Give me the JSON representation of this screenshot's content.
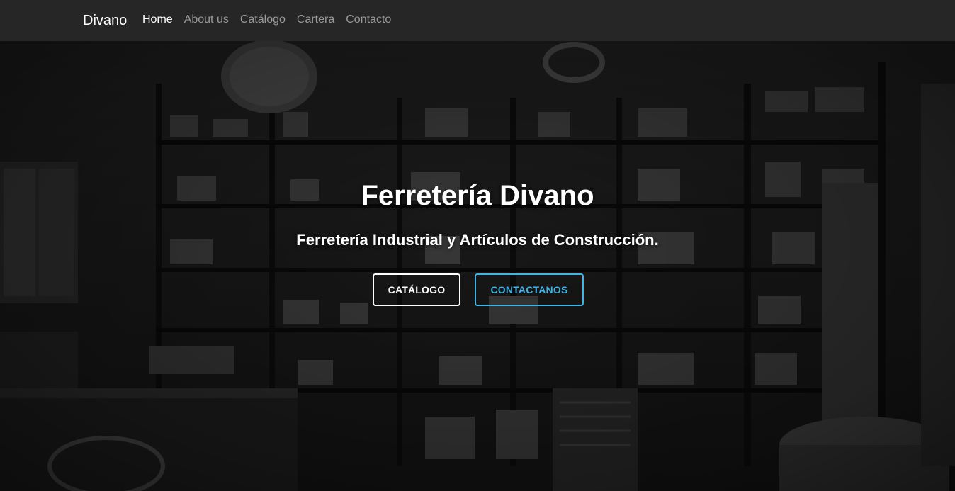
{
  "navbar": {
    "brand": "Divano",
    "items": [
      {
        "label": "Home",
        "active": true
      },
      {
        "label": "About us",
        "active": false
      },
      {
        "label": "Catálogo",
        "active": false
      },
      {
        "label": "Cartera",
        "active": false
      },
      {
        "label": "Contacto",
        "active": false
      }
    ]
  },
  "hero": {
    "title": "Ferretería Divano",
    "subtitle": "Ferretería Industrial y Artículos de Construcción.",
    "buttons": {
      "catalogo": "CATÁLOGO",
      "contact": "CONTACTANOS"
    },
    "background_icon": "hardware-store-photo"
  },
  "colors": {
    "navbar_bg": "#262626",
    "accent": "#3fb4e6",
    "text": "#ffffff",
    "nav_inactive": "#9a9a9a"
  }
}
